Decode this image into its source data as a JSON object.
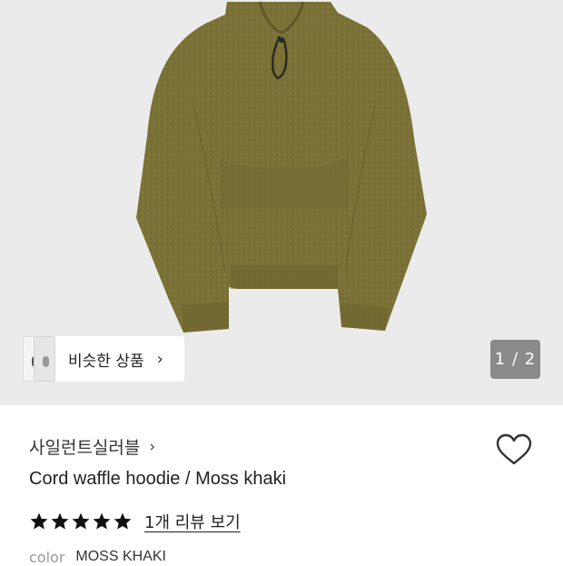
{
  "similar_products": {
    "label": "비슷한 상품",
    "chevron": "›"
  },
  "gallery": {
    "pager": "1 / 2"
  },
  "brand": {
    "name": "사일런트실러블",
    "chevron": "›"
  },
  "product": {
    "name": "Cord waffle hoodie / Moss khaki",
    "color_main": "#7a7136"
  },
  "rating": {
    "stars": 5,
    "review_link": "1개 리뷰 보기"
  },
  "color": {
    "label": "color",
    "value": "MOSS KHAKI"
  },
  "icons": {
    "wishlist": "heart-icon",
    "rating": "star-icon"
  }
}
